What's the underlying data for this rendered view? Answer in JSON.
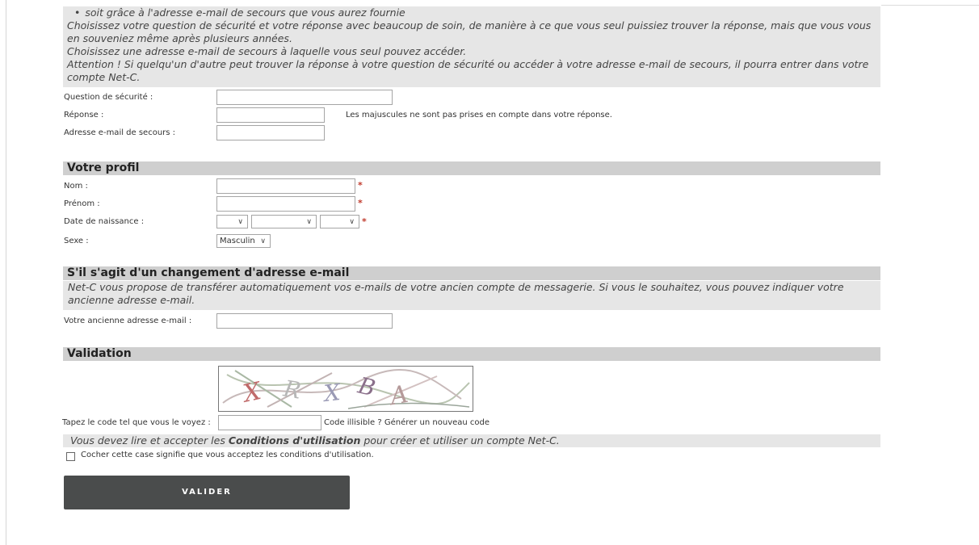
{
  "security_info": {
    "bullet": "soit grâce à l'adresse e-mail de secours que vous aurez fournie",
    "line1": "Choisissez votre question de sécurité et votre réponse avec beaucoup de soin, de manière à ce que vous seul puissiez trouver la réponse, mais que vous vous en souveniez même après plusieurs années.",
    "line2": "Choisissez une adresse e-mail de secours à laquelle vous seul pouvez accéder.",
    "line3": "Attention ! Si quelqu'un d'autre peut trouver la réponse à votre question de sécurité ou accéder à votre adresse e-mail de secours, il pourra entrer dans votre compte Net-C."
  },
  "security": {
    "question_label": "Question de sécurité :",
    "question_value": "",
    "answer_label": "Réponse :",
    "answer_value": "",
    "answer_note": "Les majuscules ne sont pas prises en compte dans votre réponse.",
    "backup_email_label": "Adresse e-mail de secours :",
    "backup_email_value": ""
  },
  "profile": {
    "header": "Votre profil",
    "nom_label": "Nom :",
    "prenom_label": "Prénom :",
    "birthdate_label": "Date de naissance :",
    "sexe_label": "Sexe :",
    "sexe_selected": "Masculin",
    "required_mark": "*"
  },
  "email_change": {
    "header": "S'il s'agit d'un changement d'adresse e-mail",
    "info": "Net-C vous propose de transférer automatiquement vos e-mails de votre ancien compte de messagerie. Si vous le souhaitez, vous pouvez indiquer votre ancienne adresse e-mail.",
    "old_email_label": "Votre ancienne adresse e-mail :",
    "old_email_value": ""
  },
  "validation": {
    "header": "Validation",
    "captcha_letters": [
      "X",
      "R",
      "X",
      "B",
      "A"
    ],
    "code_label": "Tapez le code tel que vous le voyez :",
    "code_value": "",
    "regenerate": "Code illisible ? Générer un nouveau code",
    "terms_prefix": "Vous devez lire et accepter les ",
    "terms_link": "Conditions d'utilisation",
    "terms_suffix": " pour créer et utiliser un compte Net-C.",
    "checkbox_label": "Cocher cette case signifie que vous acceptez les conditions d'utilisation.",
    "submit_label": "VALIDER"
  },
  "icons": {
    "select": "chevron-down-icon"
  },
  "colors": {
    "section_header": "#cfcfcf",
    "info_box": "#e6e6e6",
    "button": "#4a4c4c",
    "required": "#c0392b"
  }
}
